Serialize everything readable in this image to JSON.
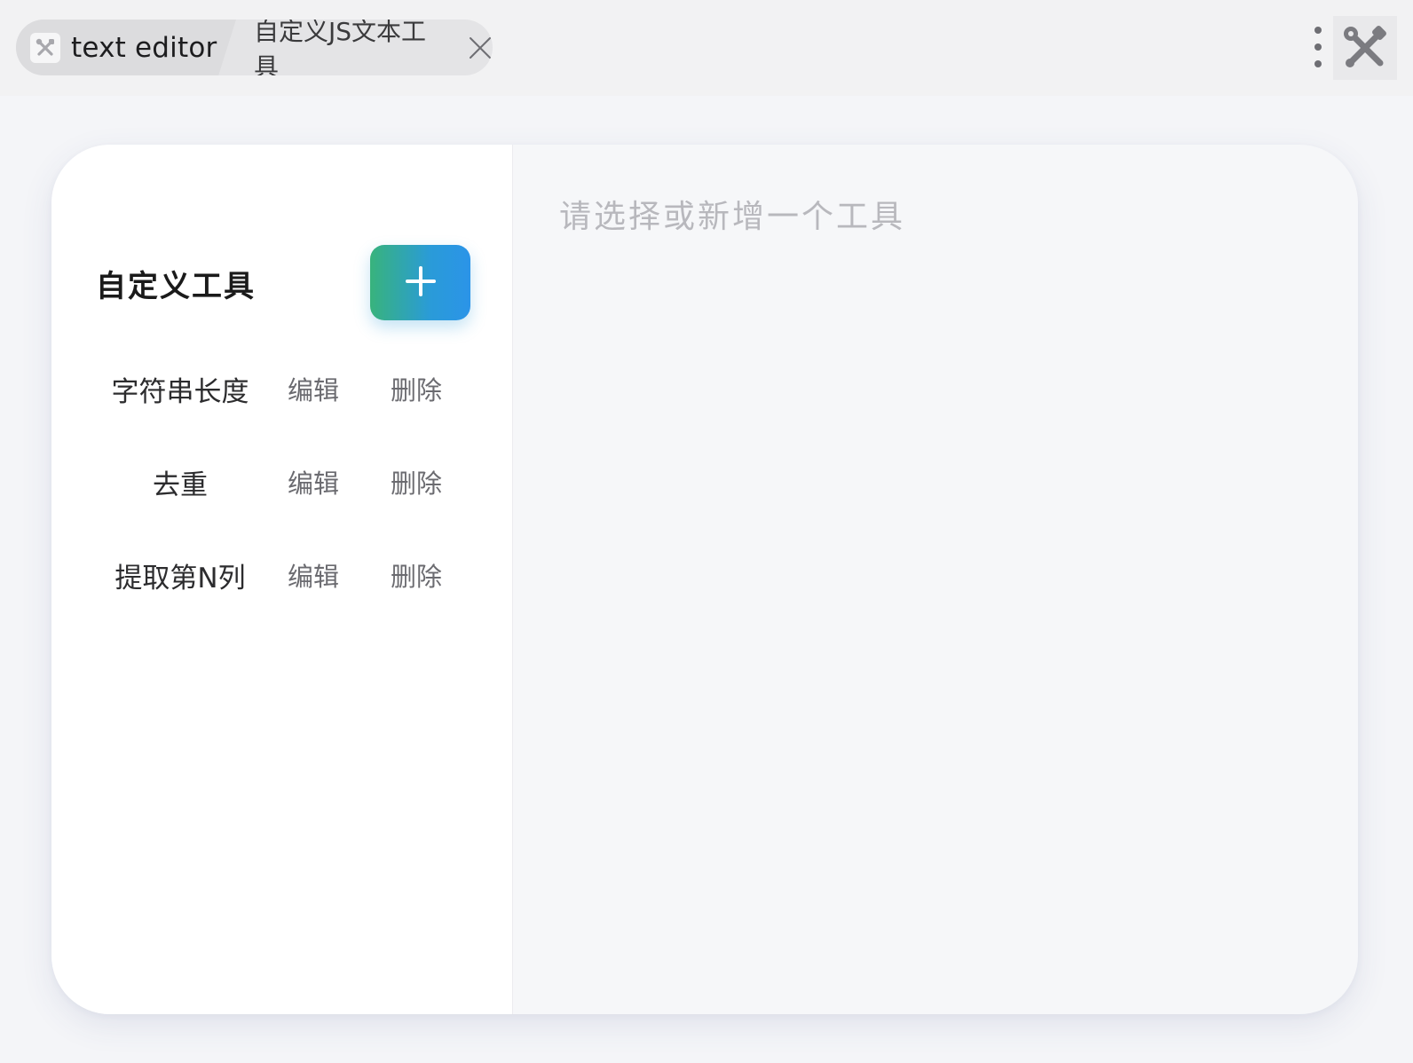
{
  "header": {
    "breadcrumb": [
      {
        "label": "text editor",
        "icon": "tools-icon"
      },
      {
        "label": "自定义JS文本工具",
        "icon": "close-icon"
      }
    ],
    "menu_icon": "more-vertical-icon",
    "app_logo_icon": "tools-icon"
  },
  "sidebar": {
    "title": "自定义工具",
    "add_button_icon": "plus-icon",
    "items": [
      {
        "name": "字符串长度",
        "edit": "编辑",
        "delete": "删除"
      },
      {
        "name": "去重",
        "edit": "编辑",
        "delete": "删除"
      },
      {
        "name": "提取第N列",
        "edit": "编辑",
        "delete": "删除"
      }
    ]
  },
  "main": {
    "placeholder": "请选择或新增一个工具"
  },
  "colors": {
    "accent_start": "#38b37c",
    "accent_end": "#2b94e8",
    "sidebar_bg": "#ffffff",
    "content_bg": "#f6f7f9"
  }
}
